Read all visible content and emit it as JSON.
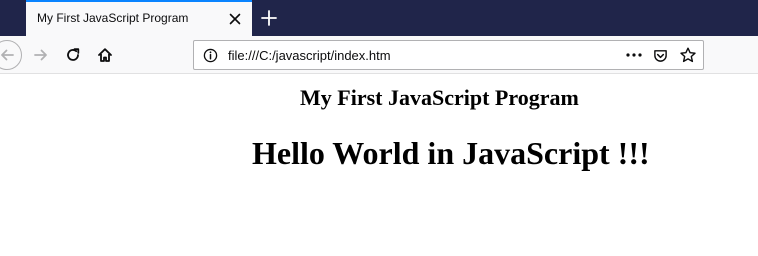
{
  "browser": {
    "tab": {
      "title": "My First JavaScript Program",
      "close_icon": "close-icon",
      "active_accent": "#0a84ff"
    },
    "new_tab_icon": "plus-icon",
    "toolbar": {
      "back_icon": "back-arrow-icon",
      "forward_icon": "forward-arrow-icon",
      "reload_icon": "reload-icon",
      "home_icon": "home-icon"
    },
    "urlbar": {
      "info_icon": "info-icon",
      "url": "file:///C:/javascript/index.htm",
      "page_actions_icon": "more-dots-icon",
      "pocket_icon": "pocket-icon",
      "bookmark_icon": "star-icon"
    },
    "colors": {
      "tabstrip": "#20254a",
      "toolbar": "#f9f9fa"
    }
  },
  "page": {
    "heading_small": "My First JavaScript Program",
    "heading_large": "Hello World in JavaScript !!!"
  }
}
